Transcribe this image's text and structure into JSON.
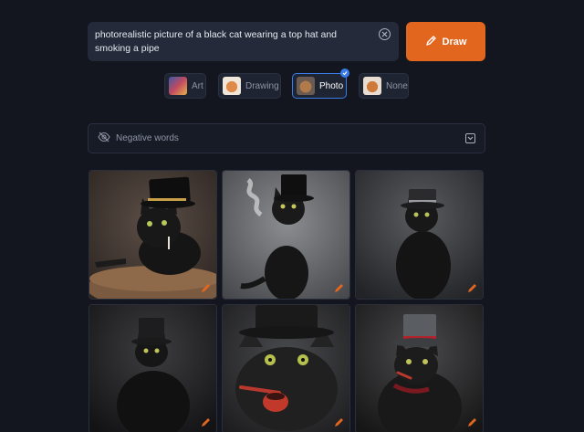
{
  "prompt": {
    "text": "photorealistic picture of a black cat wearing a top hat and smoking a pipe",
    "clear_icon": "close-circle-icon"
  },
  "draw_button": {
    "label": "Draw",
    "icon": "pencil-icon",
    "color": "#e2661e"
  },
  "styles": {
    "selected": "Photo",
    "options": [
      {
        "label": "Art",
        "thumb_color": "#c04a60"
      },
      {
        "label": "Drawing",
        "thumb_color": "#e08a4a"
      },
      {
        "label": "Photo",
        "thumb_color": "#b07a4a"
      },
      {
        "label": "None",
        "thumb_color": "#d07a3a"
      }
    ],
    "accent": "#3a7ce8"
  },
  "negative": {
    "label": "Negative words",
    "icon": "eye-off-icon",
    "toggle_icon": "chevron-down-icon"
  },
  "images": [
    {
      "alt": "black cat with gold-banded top hat on wooden table with cigarette"
    },
    {
      "alt": "black cat in top hat with smoke on grey background"
    },
    {
      "alt": "black cat wearing silver-banded top hat"
    },
    {
      "alt": "black cat in top hat in dark studio"
    },
    {
      "alt": "black cat in top hat with red pipe"
    },
    {
      "alt": "black cat with red-banded top hat and cigar"
    }
  ]
}
